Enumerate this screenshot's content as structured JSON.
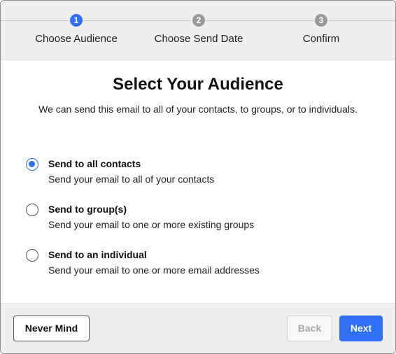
{
  "stepper": {
    "steps": [
      {
        "number": "1",
        "label": "Choose Audience",
        "active": true
      },
      {
        "number": "2",
        "label": "Choose Send Date",
        "active": false
      },
      {
        "number": "3",
        "label": "Confirm",
        "active": false
      }
    ]
  },
  "main": {
    "title": "Select Your Audience",
    "subtitle": "We can send this email to all of your contacts, to groups, or to individuals.",
    "options": [
      {
        "title": "Send to all contacts",
        "description": "Send your email to all of your contacts",
        "selected": true
      },
      {
        "title": "Send to group(s)",
        "description": "Send your email to one or more existing groups",
        "selected": false
      },
      {
        "title": "Send to an individual",
        "description": "Send your email to one or more email addresses",
        "selected": false
      }
    ]
  },
  "footer": {
    "never_mind_label": "Never Mind",
    "back_label": "Back",
    "next_label": "Next"
  },
  "colors": {
    "accent": "#2f6ff5",
    "inactive_step": "#9a9a9a",
    "panel_gray": "#efefef"
  }
}
